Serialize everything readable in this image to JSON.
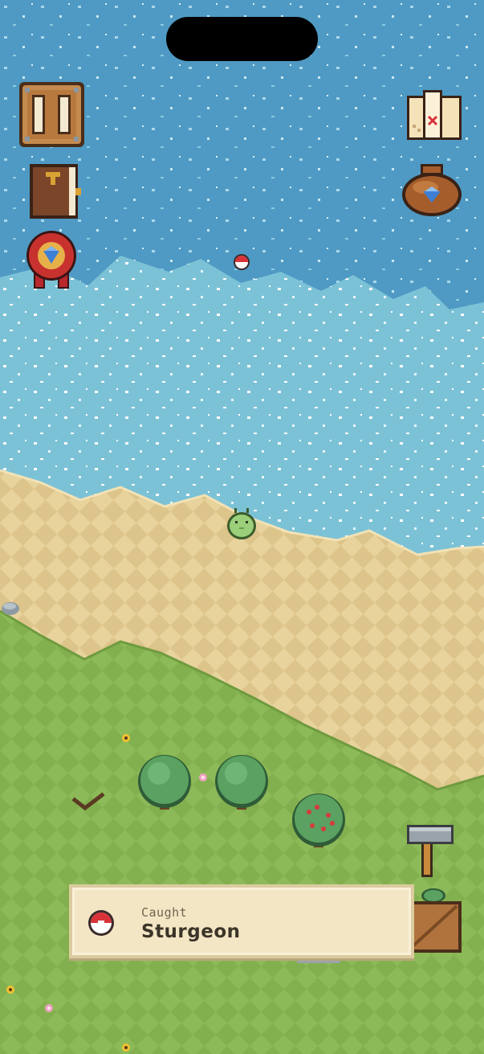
{
  "notification": {
    "subtitle": "Caught",
    "title": "Sturgeon",
    "icon": "bobber-icon"
  },
  "hud": {
    "left_buttons": [
      "pause-button",
      "journal-button",
      "badge-button"
    ],
    "right_buttons": [
      "map-button",
      "gem-bag-button"
    ],
    "tools": [
      "hammer-tool",
      "crate-storage"
    ]
  },
  "colors": {
    "deep_water": "#4f9ac4",
    "shallow_water": "#7cc2d6",
    "sand": "#e6cf96",
    "grass": "#8fba5a",
    "toast_bg": "#f3e6c5"
  }
}
